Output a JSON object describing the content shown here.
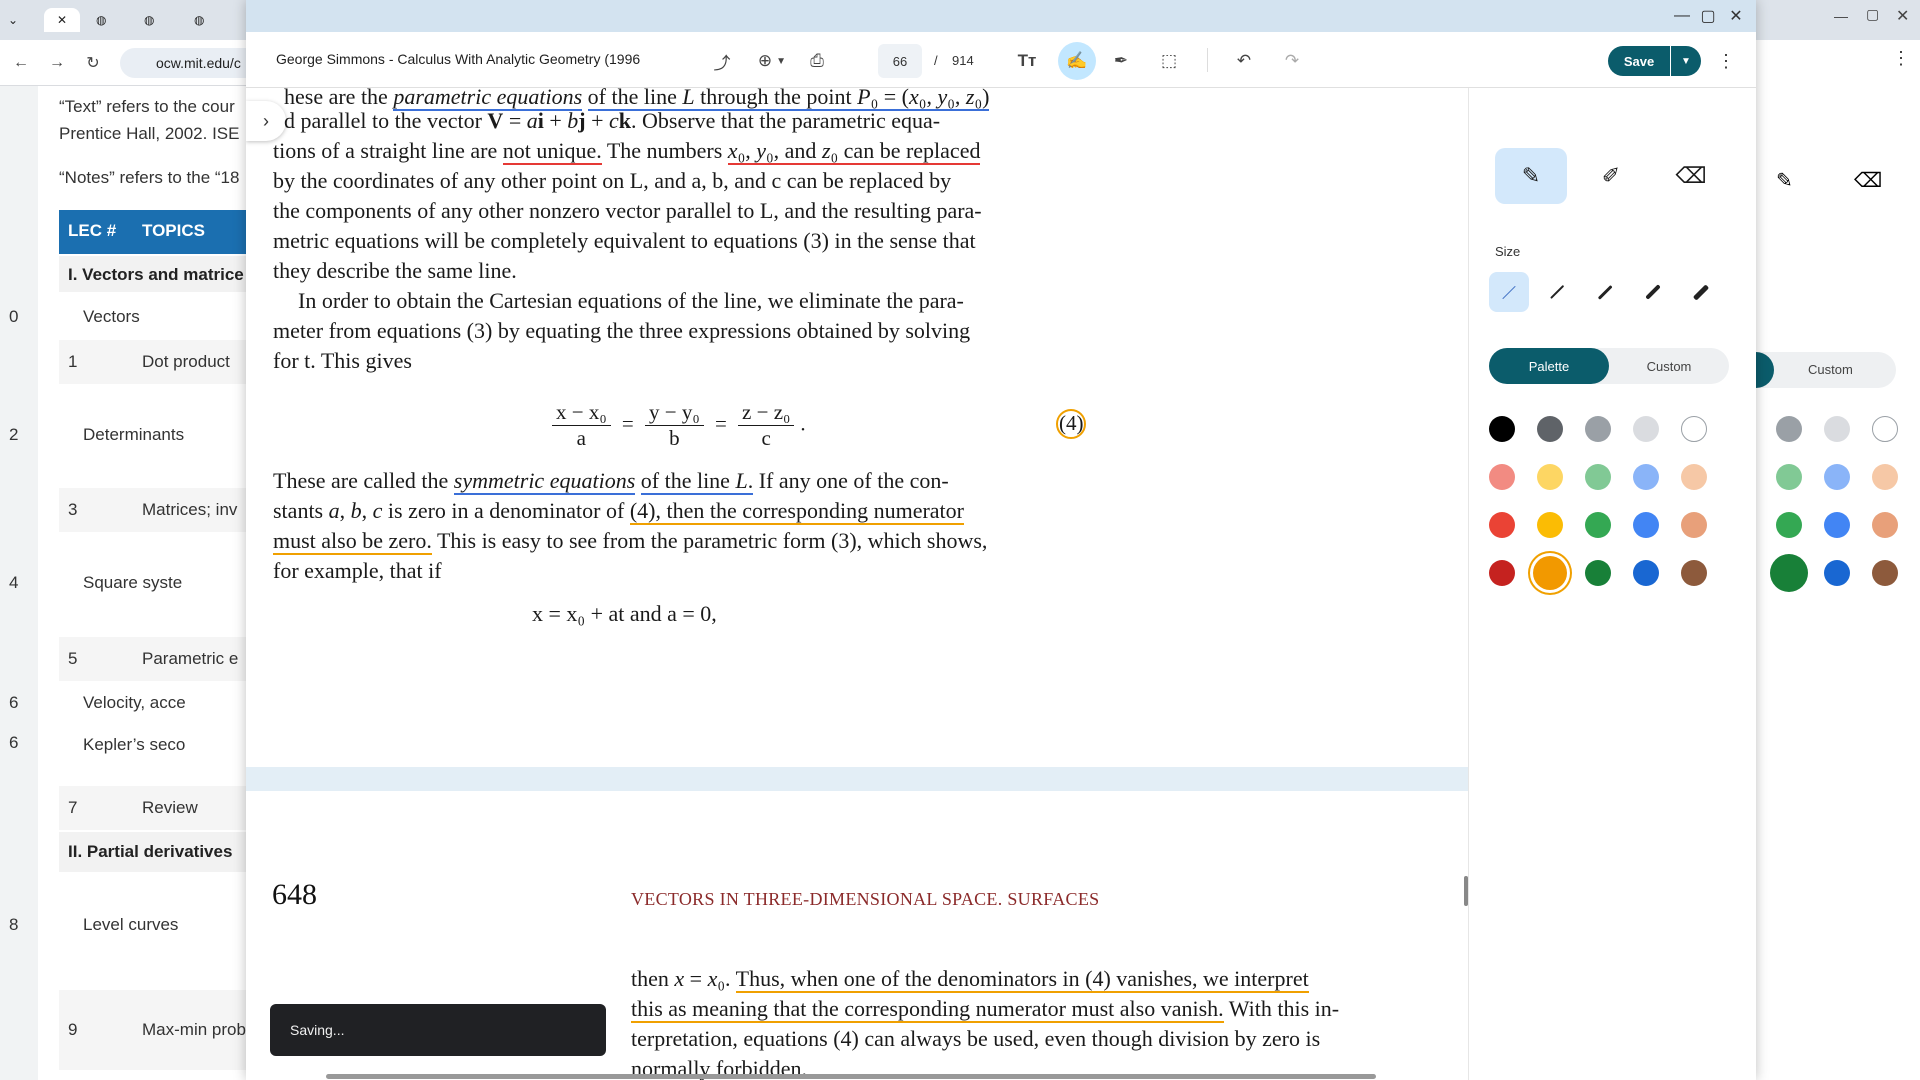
{
  "background_browser": {
    "omnibox_text": "ocw.mit.edu/c",
    "lines": [
      {
        "text": "“Text” refers to the cour"
      },
      {
        "text": "Prentice Hall, 2002. ISE"
      },
      {
        "text": "“Notes” refers to the “18"
      }
    ],
    "table": {
      "header_num": "LEC #",
      "header_topics": "TOPICS",
      "section1": "I. Vectors and matrice",
      "rows": [
        {
          "num": "0",
          "topic": "Vectors"
        },
        {
          "num": "1",
          "topic": "Dot product"
        },
        {
          "num": "2",
          "topic": "Determinants"
        },
        {
          "num": "3",
          "topic": "Matrices; inv"
        },
        {
          "num": "4",
          "topic": "Square syste"
        },
        {
          "num": "5",
          "topic": "Parametric e"
        },
        {
          "num": "6",
          "topic": "Velocity, acce"
        },
        {
          "num": "",
          "topic": "Kepler’s seco"
        },
        {
          "num": "7",
          "topic": "Review"
        },
        {
          "num": "8",
          "topic": "Level curves"
        },
        {
          "num": "9",
          "topic": "Max-min prob"
        }
      ],
      "section2": "II. Partial derivatives"
    }
  },
  "viewer": {
    "doc_title": "George Simmons - Calculus With Analytic Geometry (1996",
    "page_current": "66",
    "page_sep": "/",
    "page_total": "914",
    "save_label": "Save",
    "toast_text": "Saving...",
    "icons": [
      "share-icon",
      "zoom-icon",
      "print-icon",
      "text-icon",
      "draw-icon",
      "signature-icon",
      "select-icon",
      "undo-icon",
      "redo-icon"
    ]
  },
  "document": {
    "lines_page1": [
      "hese are the parametric equations of the line L through the point P₀ = (x₀, y₀, z₀)",
      "d parallel to the vector V = ai + bj + ck. Observe that the parametric equa-",
      "tions of a straight line are not unique. The numbers x₀, y₀, and z₀ can be replaced",
      "by the coordinates of any other point on L, and a, b, and c can be replaced by",
      "the components of any other nonzero vector parallel to L, and the resulting para-",
      "metric equations will be completely equivalent to equations (3) in the sense that",
      "they describe the same line.",
      "In order to obtain the Cartesian equations of the line, we eliminate the para-",
      "meter from equations (3) by equating the three expressions obtained by solving",
      "for t. This gives"
    ],
    "equation": {
      "n1": "x − x₀",
      "d1": "a",
      "n2": "y − y₀",
      "d2": "b",
      "n3": "z − z₀",
      "d3": "c",
      "eq": "=",
      "tag": "(4)"
    },
    "lines_page1b": [
      "These are called the symmetric equations of the line L. If any one of the con-",
      "stants a, b, c is zero in a denominator of (4), then the corresponding numerator",
      "must also be zero. This is easy to see from the parametric form (3), which shows,",
      "for example, that if"
    ],
    "cond_eq": "x = x₀ + at        and        a = 0,",
    "page2_num": "648",
    "page2_head": "VECTORS IN THREE-DIMENSIONAL SPACE. SURFACES",
    "lines_page2": [
      "then x = x₀. Thus, when one of the denominators in (4) vanishes, we interpret",
      "this as meaning that the corresponding numerator must also vanish. With this in-",
      "terpretation, equations (4) can always be used, even though division by zero is",
      "normally forbidden."
    ]
  },
  "annotation_panel": {
    "size_label": "Size",
    "palette_label": "Palette",
    "custom_label": "Custom",
    "swatches": [
      [
        "#000000",
        "#5f6368",
        "#9aa0a6",
        "#dadce0",
        "#ffffff"
      ],
      [
        "#f28b82",
        "#fdd663",
        "#81c995",
        "#8ab4f8",
        "#f6c8a6"
      ],
      [
        "#ea4335",
        "#fbbc04",
        "#34a853",
        "#4285f4",
        "#e8a07a"
      ],
      [
        "#c5221f",
        "#f29900",
        "#188038",
        "#1967d2",
        "#8d5a3c"
      ]
    ],
    "selected_swatch": "#f29900"
  },
  "colors": {
    "accent": "#0b5c6b",
    "highlight_blue": "#3a6fd8",
    "highlight_red": "#e53935",
    "highlight_orange": "#f0a000"
  }
}
